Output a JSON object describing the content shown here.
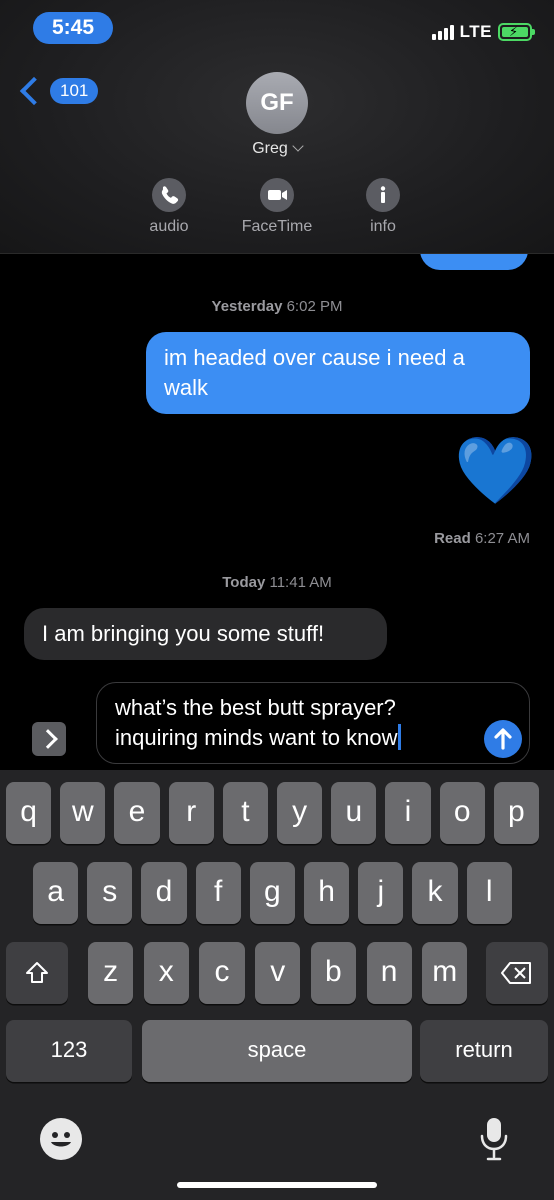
{
  "status_bar": {
    "time": "5:45",
    "network": "LTE"
  },
  "nav": {
    "back_count": "101"
  },
  "contact": {
    "initials": "GF",
    "name": "Greg"
  },
  "actions": [
    {
      "label": "audio",
      "icon": "phone-icon"
    },
    {
      "label": "FaceTime",
      "icon": "video-camera-icon"
    },
    {
      "label": "info",
      "icon": "info-icon"
    }
  ],
  "messages": [
    {
      "type": "timestamp",
      "day": "Yesterday",
      "time": "6:02 PM"
    },
    {
      "type": "outgoing",
      "text": "im headed over cause i need a walk"
    },
    {
      "type": "outgoing-emoji",
      "text": "💙"
    },
    {
      "type": "receipt",
      "label": "Read",
      "time": "6:27 AM"
    },
    {
      "type": "timestamp",
      "day": "Today",
      "time": "11:41 AM"
    },
    {
      "type": "incoming",
      "text": "I am bringing you some stuff!"
    }
  ],
  "compose": {
    "line1": "what’s the best butt sprayer?",
    "line2": "inquiring minds want to know"
  },
  "keyboard": {
    "row1": [
      "q",
      "w",
      "e",
      "r",
      "t",
      "y",
      "u",
      "i",
      "o",
      "p"
    ],
    "row2": [
      "a",
      "s",
      "d",
      "f",
      "g",
      "h",
      "j",
      "k",
      "l"
    ],
    "row3": [
      "z",
      "x",
      "c",
      "v",
      "b",
      "n",
      "m"
    ],
    "numbers_label": "123",
    "space_label": "space",
    "return_label": "return"
  },
  "colors": {
    "accent": "#2f7ce6",
    "outgoing_bubble": "#3c8ef3",
    "incoming_bubble": "#2a2a2c",
    "battery": "#4cd964"
  }
}
